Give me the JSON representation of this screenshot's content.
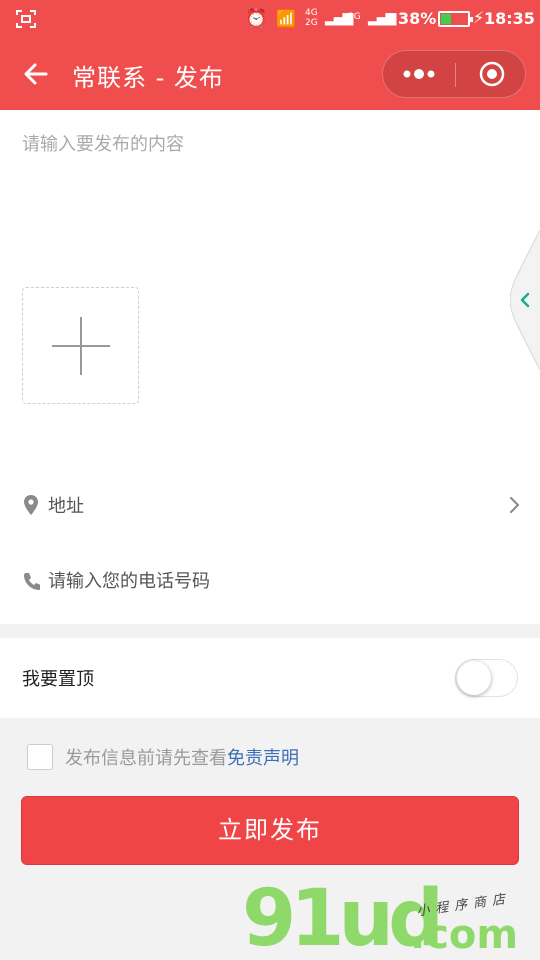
{
  "statusbar": {
    "battery_percent": "38%",
    "battery_level": 0.38,
    "time": "18:35",
    "network_1": "4G\n2G",
    "network_2": "2G"
  },
  "navbar": {
    "title": "常联系 - 发布",
    "color": "#f04e4e"
  },
  "form": {
    "content_placeholder": "请输入要发布的内容",
    "address_label": "地址",
    "phone_placeholder": "请输入您的电话号码",
    "pin_label": "我要置顶",
    "pin_enabled": false,
    "agree_text": "发布信息前请先查看",
    "agree_link": "免责声明",
    "agree_checked": false,
    "submit_label": "立即发布"
  },
  "watermark": {
    "logo": "91ud",
    "domain": ".com",
    "tagline": "小程序商店"
  }
}
